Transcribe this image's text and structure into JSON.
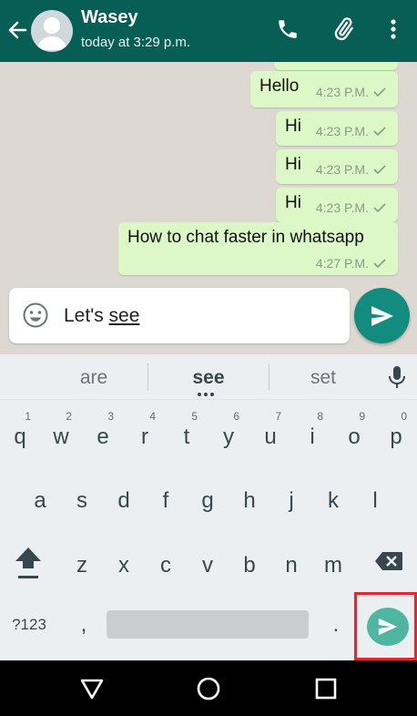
{
  "header": {
    "contact_name": "Wasey",
    "last_seen": "today at 3:29 p.m.",
    "icons": [
      "back-arrow-icon",
      "avatar",
      "phone-icon",
      "attach-icon",
      "more-vert-icon"
    ],
    "bg_color": "#075e54"
  },
  "messages": [
    {
      "text": "Hello",
      "time": "4:23 P.M."
    },
    {
      "text": "Hi",
      "time": "4:23 P.M."
    },
    {
      "text": "Hi",
      "time": "4:23 P.M."
    },
    {
      "text": "Hi",
      "time": "4:23 P.M."
    },
    {
      "text": "How to chat faster in whatsapp",
      "time": "4:27 P.M."
    }
  ],
  "composer": {
    "text_prefix": "Let's ",
    "text_underlined": "see"
  },
  "keyboard": {
    "suggestions": [
      "are",
      "see",
      "set"
    ],
    "row1": [
      {
        "k": "q",
        "n": "1"
      },
      {
        "k": "w",
        "n": "2"
      },
      {
        "k": "e",
        "n": "3"
      },
      {
        "k": "r",
        "n": "4"
      },
      {
        "k": "t",
        "n": "5"
      },
      {
        "k": "y",
        "n": "6"
      },
      {
        "k": "u",
        "n": "7"
      },
      {
        "k": "i",
        "n": "8"
      },
      {
        "k": "o",
        "n": "9"
      },
      {
        "k": "p",
        "n": "0"
      }
    ],
    "row2": [
      "a",
      "s",
      "d",
      "f",
      "g",
      "h",
      "j",
      "k",
      "l"
    ],
    "row3": [
      "z",
      "x",
      "c",
      "v",
      "b",
      "n",
      "m"
    ],
    "symbols_label": "?123",
    "comma": ",",
    "period": "."
  },
  "colors": {
    "bubble": "#dcf8c6",
    "send_button": "#128c7e",
    "enter_key": "#4fb6a2",
    "highlight": "#e32730"
  }
}
